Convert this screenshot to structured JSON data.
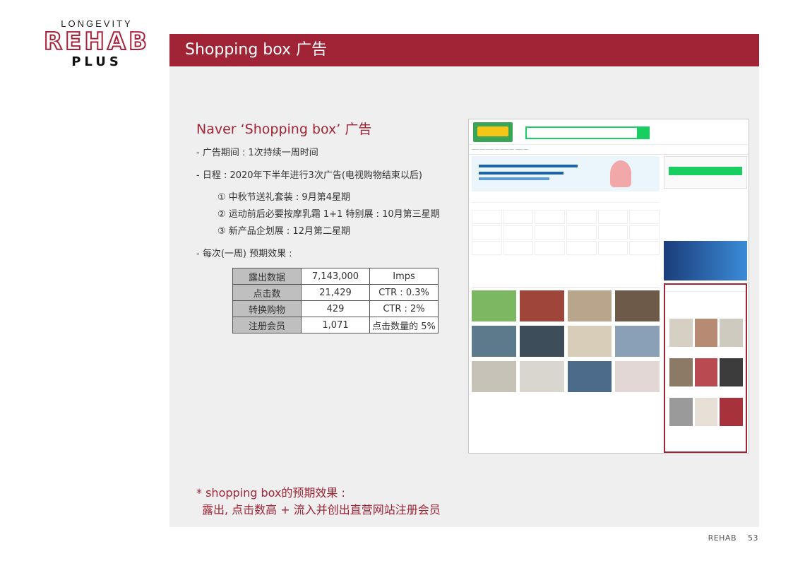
{
  "logo": {
    "top": "LONGEVITY",
    "middle": "REHAB",
    "bottom": "PLUS"
  },
  "header": {
    "title": "Shopping box 广告"
  },
  "section": {
    "title": "Naver ‘Shopping box’ 广告",
    "period": "- 广告期间 : 1次持续一周时间",
    "schedule": "- 日程 : 2020年下半年进行3次广告(电视购物结束以后)",
    "items": [
      "① 中秋节送礼套装 : 9月第4星期",
      "② 运动前后必要按摩乳霜 1+1 特别展 : 10月第三星期",
      "③ 新产品企划展 : 12月第二星期"
    ],
    "effect_label": "- 每次(一周) 预期效果 :"
  },
  "kpi_table": [
    {
      "label": "露出数据",
      "value": "7,143,000",
      "extra": "Imps"
    },
    {
      "label": "点击数",
      "value": "21,429",
      "extra": "CTR : 0.3%"
    },
    {
      "label": "转换购物",
      "value": "429",
      "extra": "CTR : 2%"
    },
    {
      "label": "注册会员",
      "value": "1,071",
      "extra": "点击数量的 5%"
    }
  ],
  "note": {
    "line1": "* shopping box的预期效果 :",
    "line2": "露出, 点击数高 + 流入并创出直营网站注册会员"
  },
  "footer": {
    "brand": "REHAB",
    "page": "53"
  }
}
